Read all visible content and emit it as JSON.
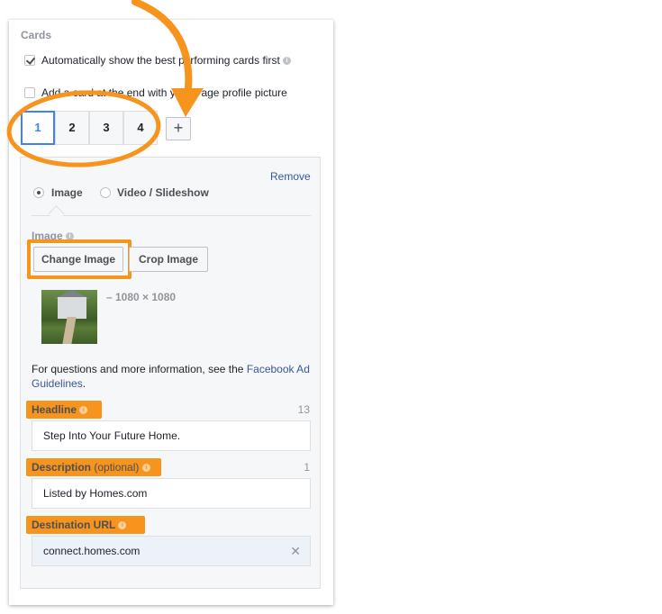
{
  "cards": {
    "title": "Cards",
    "option_auto": "Automatically show the best performing cards first",
    "option_profile": "Add a card at the end with your Page profile picture",
    "tabs": [
      "1",
      "2",
      "3",
      "4"
    ],
    "add_label": "+",
    "remove_label": "Remove",
    "media_type": {
      "image_label": "Image",
      "video_label": "Video / Slideshow",
      "selected": "Image"
    },
    "image_section_label": "Image",
    "change_image_label": "Change Image",
    "crop_image_label": "Crop Image",
    "image_dimensions": "– 1080 × 1080",
    "help_text": "For questions and more information, see the",
    "help_link_line1": "Facebook Ad",
    "help_link_line2": "Guidelines",
    "help_period": "."
  },
  "fields": {
    "headline": {
      "label": "Headline",
      "count": "13",
      "value": "Step Into Your Future Home."
    },
    "description": {
      "label": "Description",
      "optional": "(optional)",
      "count": "1",
      "value": "Listed by Homes.com"
    },
    "destination": {
      "label": "Destination URL",
      "value": "connect.homes.com",
      "clear": "✕"
    }
  },
  "colors": {
    "accent_orange": "#f7941d",
    "link_blue": "#365899",
    "active_tab_blue": "#4080ff"
  },
  "icons": {
    "info": "info-icon",
    "check": "checkmark-icon",
    "clear": "close-icon"
  }
}
